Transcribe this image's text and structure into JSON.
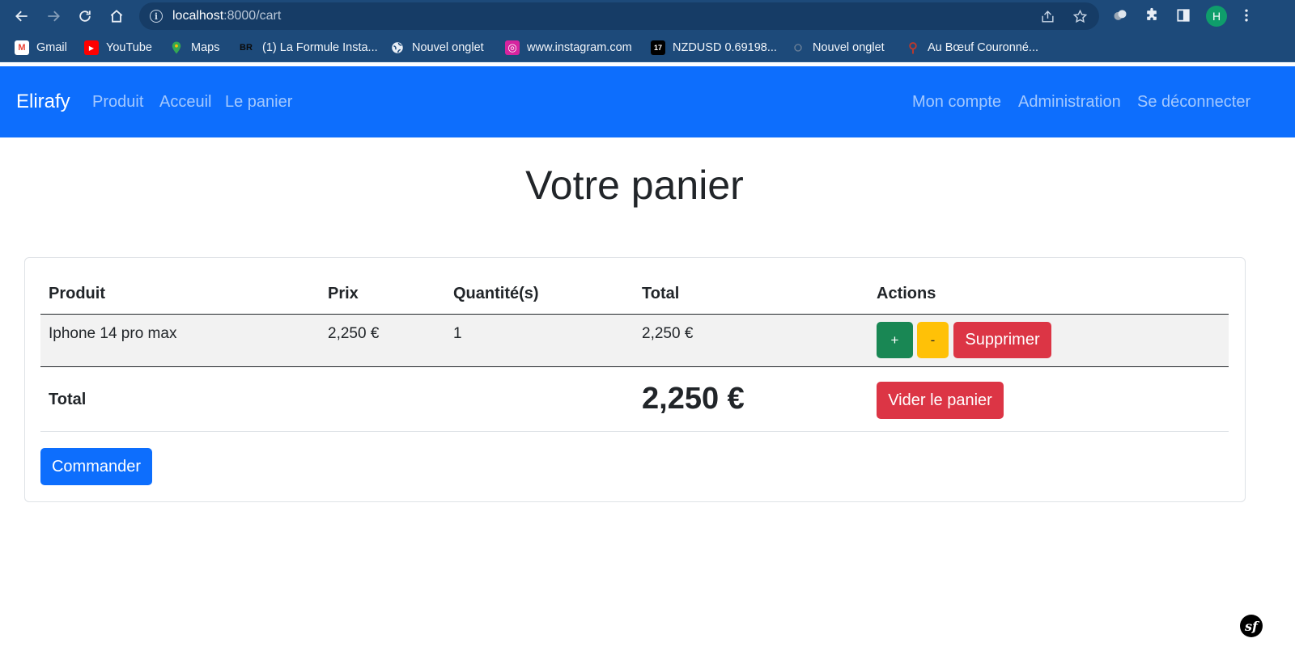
{
  "browser": {
    "url_host": "localhost",
    "url_path": ":8000/cart",
    "profile_initial": "H",
    "bookmarks": [
      {
        "label": "Gmail",
        "icon": "gmail-icon",
        "glyph": "M"
      },
      {
        "label": "YouTube",
        "icon": "youtube-icon",
        "glyph": "▶"
      },
      {
        "label": "Maps",
        "icon": "maps-icon",
        "glyph": ""
      },
      {
        "label": "(1) La Formule Insta...",
        "icon": "br-icon",
        "glyph": "BR"
      },
      {
        "label": "Nouvel onglet",
        "icon": "globe-icon",
        "glyph": ""
      },
      {
        "label": "www.instagram.com",
        "icon": "instagram-icon",
        "glyph": "◎"
      },
      {
        "label": "NZDUSD 0.69198...",
        "icon": "tradingview-icon",
        "glyph": "17"
      },
      {
        "label": "Nouvel onglet",
        "icon": "new-tab-icon",
        "glyph": ""
      },
      {
        "label": "Au Bœuf Couronné...",
        "icon": "restaurant-icon",
        "glyph": ""
      }
    ]
  },
  "navbar": {
    "brand": "Elirafy",
    "links_left": [
      "Produit",
      "Acceuil",
      "Le panier"
    ],
    "links_right": [
      "Mon compte",
      "Administration",
      "Se déconnecter"
    ]
  },
  "page": {
    "title": "Votre panier"
  },
  "cart": {
    "headers": {
      "product": "Produit",
      "price": "Prix",
      "quantity": "Quantité(s)",
      "total": "Total",
      "actions": "Actions"
    },
    "items": [
      {
        "product": "Iphone 14 pro max",
        "price": "2,250 €",
        "quantity": "1",
        "total": "2,250 €"
      }
    ],
    "actions": {
      "increase": "+",
      "decrease": "-",
      "remove": "Supprimer"
    },
    "total_label": "Total",
    "total_value": "2,250 €",
    "empty_cart": "Vider le panier",
    "order": "Commander"
  },
  "debug_toolbar": {
    "glyph": "sf"
  },
  "colors": {
    "primary": "#0d6efd",
    "success": "#198754",
    "warning": "#ffc107",
    "danger": "#dc3545",
    "chrome": "#1d4a7a"
  }
}
